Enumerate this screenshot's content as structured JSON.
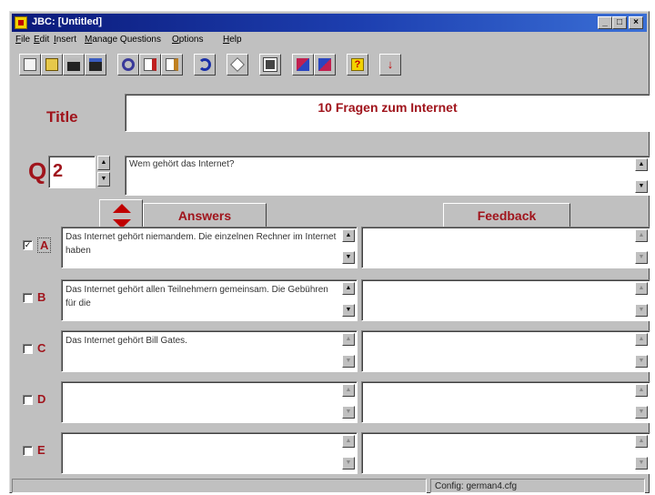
{
  "window": {
    "title": "JBC: [Untitled]"
  },
  "title_controls": {
    "minimize": "_",
    "maximize": "□",
    "close": "×"
  },
  "menu": [
    {
      "label": "File",
      "u": "F",
      "rest": "ile"
    },
    {
      "label": "Edit",
      "u": "E",
      "rest": "dit"
    },
    {
      "label": "Insert",
      "u": "I",
      "rest": "nsert"
    },
    {
      "label": "Manage Questions",
      "u": "M",
      "rest": "anage Questions"
    },
    {
      "label": "Options",
      "u": "O",
      "rest": "ptions"
    },
    {
      "label": "Help",
      "u": "H",
      "rest": "elp"
    }
  ],
  "toolbar": {
    "buttons": [
      {
        "icon": "new-file-icon",
        "color": "#e8e8e8"
      },
      {
        "icon": "open-folder-icon",
        "color": "#e6c84a"
      },
      {
        "icon": "save-icon",
        "color": "#222222"
      },
      {
        "icon": "save-all-icon",
        "color": "#222222"
      },
      {
        "icon": "find-icon",
        "color": "#3a3a9a"
      },
      {
        "icon": "export-icon",
        "color": "#c02020"
      },
      {
        "icon": "import-icon",
        "color": "#c08020"
      },
      {
        "icon": "undo-icon",
        "color": "#1a2fa8"
      },
      {
        "icon": "clear-icon",
        "color": "#ffffff"
      },
      {
        "icon": "preview-icon",
        "color": "#444444"
      },
      {
        "icon": "swap-left-icon",
        "color": "#c02050"
      },
      {
        "icon": "swap-right-icon",
        "color": "#c02050"
      },
      {
        "icon": "help-icon",
        "color": "#f2d200"
      },
      {
        "icon": "down-arrow-icon",
        "color": "#c00000"
      }
    ]
  },
  "title_section": {
    "label": "Title",
    "value": "10 Fragen zum Internet"
  },
  "question": {
    "label": "Q",
    "number": "2",
    "text": "Wem gehört das Internet?"
  },
  "columns": {
    "answers": "Answers",
    "feedback": "Feedback"
  },
  "answers": [
    {
      "letter": "A",
      "checked": true,
      "text": "Das Internet gehört niemandem. Die einzelnen Rechner im Internet haben",
      "feedback": ""
    },
    {
      "letter": "B",
      "checked": false,
      "text": "Das Internet gehört allen Teilnehmern gemeinsam. Die Gebühren für die",
      "feedback": ""
    },
    {
      "letter": "C",
      "checked": false,
      "text": "Das Internet gehört Bill Gates.",
      "feedback": ""
    },
    {
      "letter": "D",
      "checked": false,
      "text": "",
      "feedback": ""
    },
    {
      "letter": "E",
      "checked": false,
      "text": "",
      "feedback": ""
    }
  ],
  "status": {
    "left": "",
    "config": "Config: german4.cfg"
  },
  "colors": {
    "accent_red": "#a0141c",
    "titlebar_start": "#0b1a7a",
    "face": "#c0c0c0"
  }
}
